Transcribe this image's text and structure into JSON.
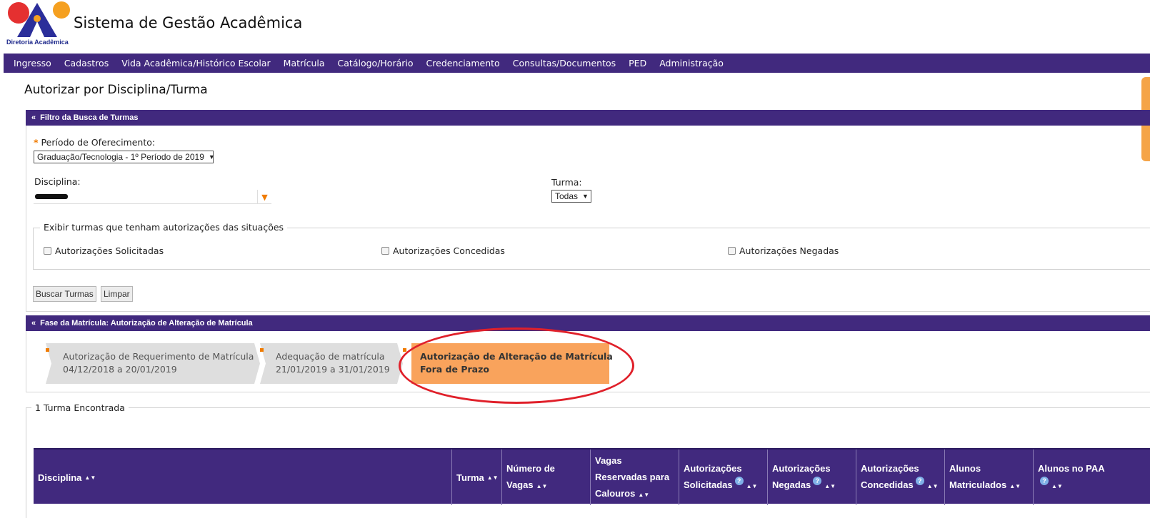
{
  "header": {
    "logo_subtitle": "Diretoria Acadêmica",
    "app_title": "Sistema de Gestão Acadêmica"
  },
  "menu": [
    "Ingresso",
    "Cadastros",
    "Vida Acadêmica/Histórico Escolar",
    "Matrícula",
    "Catálogo/Horário",
    "Credenciamento",
    "Consultas/Documentos",
    "PED",
    "Administração"
  ],
  "page_title": "Autorizar por Disciplina/Turma",
  "filter_panel": {
    "title": "Filtro da Busca de Turmas",
    "periodo_label": "Período de Oferecimento:",
    "periodo_value": "Graduação/Tecnologia - 1º Período de 2019",
    "disciplina_label": "Disciplina:",
    "turma_label": "Turma:",
    "turma_value": "Todas",
    "situacoes_legend": "Exibir turmas que tenham autorizações das situações",
    "checkboxes": [
      "Autorizações Solicitadas",
      "Autorizações Concedidas",
      "Autorizações Negadas"
    ],
    "buscar_label": "Buscar Turmas",
    "limpar_label": "Limpar"
  },
  "phase_panel": {
    "title": "Fase da Matrícula: Autorização de Alteração de Matrícula",
    "steps": [
      {
        "line1": "Autorização de Requerimento de Matrícula",
        "line2": "04/12/2018 a 20/01/2019",
        "state": "done"
      },
      {
        "line1": "Adequação de matrícula",
        "line2": "21/01/2019 a 31/01/2019",
        "state": "done"
      },
      {
        "line1": "Autorização de Alteração de Matrícula",
        "line2": "Fora de Prazo",
        "state": "current"
      }
    ]
  },
  "results": {
    "legend": "1 Turma Encontrada",
    "columns": {
      "disciplina": "Disciplina",
      "turma": "Turma",
      "numero_vagas": [
        "Número de",
        "Vagas"
      ],
      "vagas_reservadas": [
        "Vagas",
        "Reservadas para",
        "Calouros"
      ],
      "aut_solicitadas": [
        "Autorizações",
        "Solicitadas"
      ],
      "aut_negadas": [
        "Autorizações",
        "Negadas"
      ],
      "aut_concedidas": [
        "Autorizações",
        "Concedidas"
      ],
      "alunos_matriculados": [
        "Alunos",
        "Matriculados"
      ],
      "alunos_paa": "Alunos no PAA"
    }
  },
  "colors": {
    "primary": "#41297e",
    "accent": "#f07b00",
    "current_step": "#f9a35c",
    "annotation": "#e0202a"
  },
  "icons": {
    "sort": "sort-icon",
    "help": "help-icon",
    "dropdown": "dropdown-arrow-icon"
  }
}
